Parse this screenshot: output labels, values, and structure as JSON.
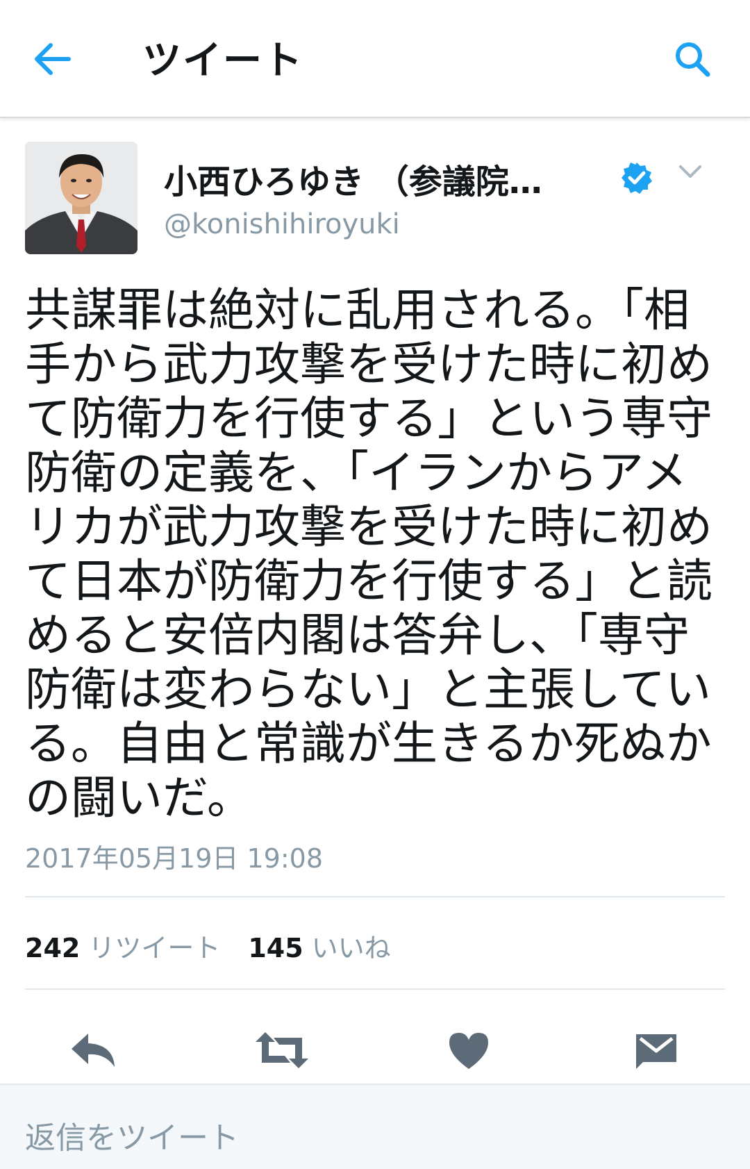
{
  "header": {
    "title": "ツイート",
    "back_icon": "arrow-left-icon",
    "search_icon": "search-icon"
  },
  "tweet": {
    "display_name": "小西ひろゆき （参議院…",
    "handle": "@konishihiroyuki",
    "verified": true,
    "text": "共謀罪は絶対に乱用される。「相手から武力攻撃を受けた時に初めて防衛力を行使する」という専守防衛の定義を、「イランからアメリカが武力攻撃を受けた時に初めて日本が防衛力を行使する」と読めると安倍内閣は答弁し、「専守防衛は変わらない」と主張している。自由と常識が生きるか死ぬかの闘いだ。",
    "timestamp": "2017年05月19日 19:08"
  },
  "stats": {
    "retweets_count": "242",
    "retweets_label": "リツイート",
    "likes_count": "145",
    "likes_label": "いいね"
  },
  "actions": [
    {
      "name": "reply",
      "icon": "reply-icon"
    },
    {
      "name": "retweet",
      "icon": "retweet-icon"
    },
    {
      "name": "like",
      "icon": "heart-icon"
    },
    {
      "name": "message",
      "icon": "envelope-icon"
    }
  ],
  "reply_box": {
    "placeholder": "返信をツイート"
  },
  "colors": {
    "accent": "#1da1f2",
    "text": "#14171a",
    "muted": "#8899a6",
    "action_icon": "#5c6b77",
    "divider": "#e1e8ed"
  }
}
